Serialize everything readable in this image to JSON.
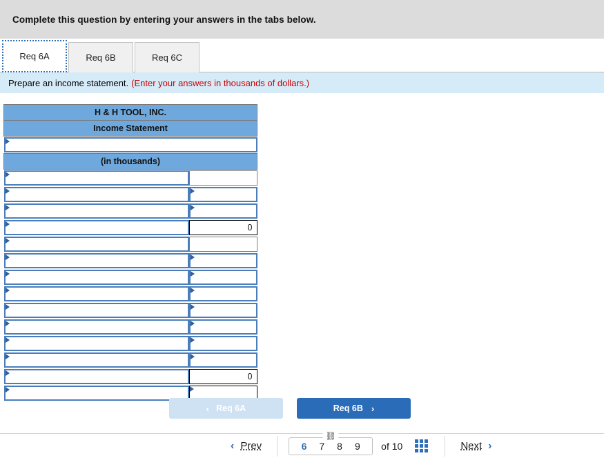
{
  "banner": {
    "text": "Complete this question by entering your answers in the tabs below."
  },
  "tabs": [
    {
      "label": "Req 6A",
      "active": true
    },
    {
      "label": "Req 6B",
      "active": false
    },
    {
      "label": "Req 6C",
      "active": false
    }
  ],
  "requirement": {
    "text": "Prepare an income statement.",
    "note": "(Enter your answers in thousands of dollars.)"
  },
  "statement": {
    "company": "H & H TOOL, INC.",
    "title": "Income Statement",
    "period_value": "",
    "units": "(in thousands)",
    "rows": [
      {
        "label": "",
        "amount": "",
        "label_marker": true,
        "amount_marker": false,
        "amount_style": "thin"
      },
      {
        "label": "",
        "amount": "",
        "label_marker": true,
        "amount_marker": true,
        "amount_style": "blue"
      },
      {
        "label": "",
        "amount": "",
        "label_marker": true,
        "amount_marker": true,
        "amount_style": "blue"
      },
      {
        "label": "",
        "amount": "0",
        "label_marker": true,
        "amount_marker": false,
        "amount_style": "black"
      },
      {
        "label": "",
        "amount": "",
        "label_marker": true,
        "amount_marker": false,
        "amount_style": "thin"
      },
      {
        "label": "",
        "amount": "",
        "label_marker": true,
        "amount_marker": true,
        "amount_style": "blue"
      },
      {
        "label": "",
        "amount": "",
        "label_marker": true,
        "amount_marker": true,
        "amount_style": "blue"
      },
      {
        "label": "",
        "amount": "",
        "label_marker": true,
        "amount_marker": true,
        "amount_style": "blue"
      },
      {
        "label": "",
        "amount": "",
        "label_marker": true,
        "amount_marker": true,
        "amount_style": "blue"
      },
      {
        "label": "",
        "amount": "",
        "label_marker": true,
        "amount_marker": true,
        "amount_style": "blue"
      },
      {
        "label": "",
        "amount": "",
        "label_marker": true,
        "amount_marker": true,
        "amount_style": "blue"
      },
      {
        "label": "",
        "amount": "",
        "label_marker": true,
        "amount_marker": true,
        "amount_style": "blue"
      },
      {
        "label": "",
        "amount": "0",
        "label_marker": true,
        "amount_marker": false,
        "amount_style": "black"
      },
      {
        "label": "",
        "amount": "",
        "label_marker": true,
        "amount_marker": true,
        "amount_style": "total"
      }
    ]
  },
  "req_nav": {
    "prev_label": "Req 6A",
    "prev_chevron": "‹",
    "next_label": "Req 6B",
    "next_chevron": "›"
  },
  "pager": {
    "prev_label": "Prev",
    "prev_chevron": "‹",
    "next_label": "Next",
    "next_chevron": "›",
    "pages": [
      "6",
      "7",
      "8",
      "9"
    ],
    "current_page": "6",
    "of_label": "of 10",
    "chain_icon": "⛓",
    "grid_icon": "grid-icon"
  },
  "colors": {
    "header_blue": "#6fa8dc",
    "input_border": "#4a7ebb",
    "accent": "#2f6fba",
    "next_button": "#2b6cb8",
    "prev_button": "#cfe2f3",
    "banner_gray": "#dcdcdc",
    "req_blue": "#d6ebf8",
    "note_red": "#cc0000"
  }
}
